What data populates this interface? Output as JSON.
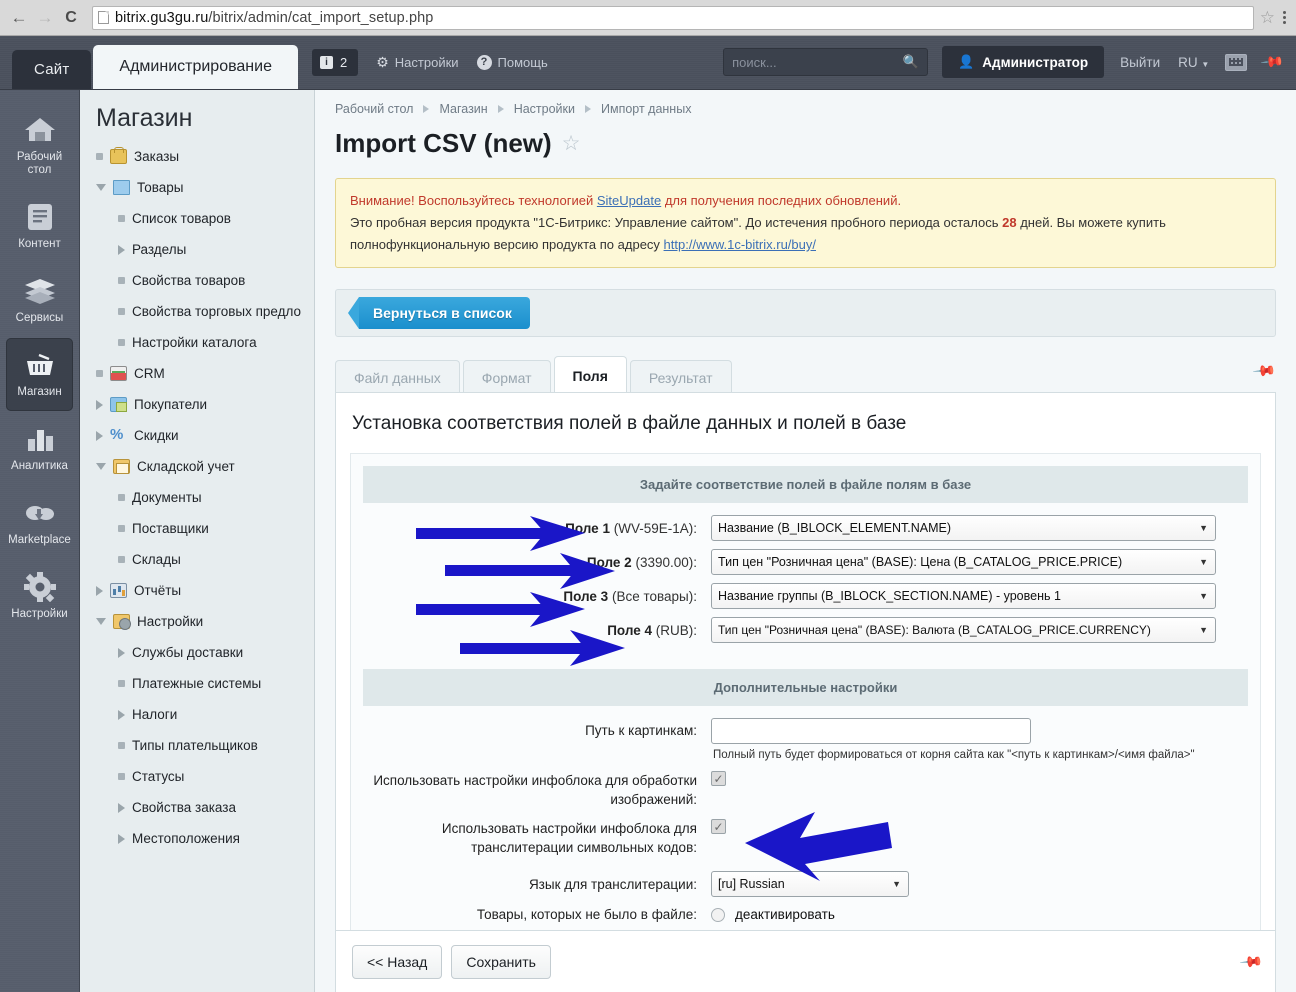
{
  "browser": {
    "url_host": "bitrix.gu3gu.ru",
    "url_path": "/bitrix/admin/cat_import_setup.php",
    "back_icon": "←",
    "forward_icon": "→",
    "reload_icon": "C",
    "bookmark_icon": "☆"
  },
  "top_panel": {
    "tab_site": "Сайт",
    "tab_admin": "Администрирование",
    "notifications_count": "2",
    "settings_label": "Настройки",
    "help_label": "Помощь",
    "search_placeholder": "поиск...",
    "admin_label": "Администратор",
    "logout_label": "Выйти",
    "lang_label": "RU",
    "accent_dark": "#2c313b",
    "panel_bg": "#4a505c"
  },
  "rail": {
    "items": [
      {
        "label": "Рабочий стол",
        "icon": "home-icon",
        "active": false
      },
      {
        "label": "Контент",
        "icon": "document-icon",
        "active": false
      },
      {
        "label": "Сервисы",
        "icon": "layers-icon",
        "active": false
      },
      {
        "label": "Магазин",
        "icon": "basket-icon",
        "active": true
      },
      {
        "label": "Аналитика",
        "icon": "bar-chart-icon",
        "active": false
      },
      {
        "label": "Marketplace",
        "icon": "cloud-download-icon",
        "active": false
      },
      {
        "label": "Настройки",
        "icon": "gear-icon",
        "active": false
      }
    ]
  },
  "subnav": {
    "title": "Магазин",
    "items": [
      {
        "label": "Заказы",
        "level": 1,
        "marker": "bullet",
        "icon": "orders-icon"
      },
      {
        "label": "Товары",
        "level": 1,
        "marker": "caret-down",
        "icon": "folder-icon"
      },
      {
        "label": "Список товаров",
        "level": 2,
        "marker": "bullet"
      },
      {
        "label": "Разделы",
        "level": 2,
        "marker": "caret-right"
      },
      {
        "label": "Свойства товаров",
        "level": 2,
        "marker": "bullet"
      },
      {
        "label": "Свойства торговых предло",
        "level": 2,
        "marker": "bullet"
      },
      {
        "label": "Настройки каталога",
        "level": 2,
        "marker": "bullet"
      },
      {
        "label": "CRM",
        "level": 1,
        "marker": "bullet",
        "icon": "crm-icon"
      },
      {
        "label": "Покупатели",
        "level": 1,
        "marker": "caret-right",
        "icon": "buyers-icon"
      },
      {
        "label": "Скидки",
        "level": 1,
        "marker": "caret-right",
        "icon": "percent-icon"
      },
      {
        "label": "Складской учет",
        "level": 1,
        "marker": "caret-down",
        "icon": "warehouse-icon"
      },
      {
        "label": "Документы",
        "level": 2,
        "marker": "bullet"
      },
      {
        "label": "Поставщики",
        "level": 2,
        "marker": "bullet"
      },
      {
        "label": "Склады",
        "level": 2,
        "marker": "bullet"
      },
      {
        "label": "Отчёты",
        "level": 1,
        "marker": "caret-right",
        "icon": "report-icon"
      },
      {
        "label": "Настройки",
        "level": 1,
        "marker": "caret-down",
        "icon": "settings-icon"
      },
      {
        "label": "Службы доставки",
        "level": 2,
        "marker": "caret-right"
      },
      {
        "label": "Платежные системы",
        "level": 2,
        "marker": "bullet"
      },
      {
        "label": "Налоги",
        "level": 2,
        "marker": "caret-right"
      },
      {
        "label": "Типы плательщиков",
        "level": 2,
        "marker": "bullet"
      },
      {
        "label": "Статусы",
        "level": 2,
        "marker": "bullet"
      },
      {
        "label": "Свойства заказа",
        "level": 2,
        "marker": "caret-right"
      },
      {
        "label": "Местоположения",
        "level": 2,
        "marker": "caret-right"
      }
    ]
  },
  "breadcrumb": {
    "items": [
      "Рабочий стол",
      "Магазин",
      "Настройки",
      "Импорт данных"
    ]
  },
  "page": {
    "title": "Import CSV (new)",
    "favorite_icon": "☆"
  },
  "notice": {
    "line1_pre": "Внимание! Воспользуйтесь технологией ",
    "line1_link": "SiteUpdate",
    "line1_post": " для получения последних обновлений.",
    "line2_pre": "Это пробная версия продукта \"1С-Битрикс: Управление сайтом\". До истечения пробного периода осталось ",
    "line2_days": "28",
    "line2_post": " дней. Вы можете купить",
    "line3_pre": "полнофункциональную версию продукта по адресу ",
    "line3_link": "http://www.1c-bitrix.ru/buy/"
  },
  "toolbar": {
    "back_to_list": "Вернуться в список"
  },
  "tabs": [
    {
      "label": "Файл данных",
      "active": false
    },
    {
      "label": "Формат",
      "active": false
    },
    {
      "label": "Поля",
      "active": true
    },
    {
      "label": "Результат",
      "active": false
    }
  ],
  "content": {
    "heading": "Установка соответствия полей в файле данных и полей в базе",
    "mapping_header": "Задайте соответствие полей в файле полям в базе",
    "fields": [
      {
        "name": "Поле 1",
        "sample": "(WV-59E-1A):",
        "value": "Название (B_IBLOCK_ELEMENT.NAME)"
      },
      {
        "name": "Поле 2",
        "sample": "(3390.00):",
        "value": "Тип цен \"Розничная цена\" (BASE): Цена (B_CATALOG_PRICE.PRICE)"
      },
      {
        "name": "Поле 3",
        "sample": "(Все товары):",
        "value": "Название группы (B_IBLOCK_SECTION.NAME) - уровень 1"
      },
      {
        "name": "Поле 4",
        "sample": "(RUB):",
        "value": "Тип цен \"Розничная цена\" (BASE): Валюта (B_CATALOG_PRICE.CURRENCY)"
      }
    ],
    "extra_header": "Дополнительные настройки",
    "image_path_label": "Путь к картинкам:",
    "image_path_value": "",
    "image_path_hint": "Полный путь будет формироваться от корня сайта как \"<путь к картинкам>/<имя файла>\"",
    "use_iblock_images_label": "Использовать настройки инфоблока для обработки изображений:",
    "use_iblock_images_checked": true,
    "use_iblock_translit_label": "Использовать настройки инфоблока для транслитерации символьных кодов:",
    "use_iblock_translit_checked": true,
    "translit_lang_label": "Язык для транслитерации:",
    "translit_lang_value": "[ru] Russian",
    "missing_products_label": "Товары, которых не было в файле:",
    "missing_products_option": "деактивировать",
    "checkbox_glyph": "✓",
    "select_caret": "▼"
  },
  "footer": {
    "back_button": "<< Назад",
    "save_button": "Сохранить"
  },
  "arrows": {
    "color": "#1a16c8",
    "count": 5
  }
}
